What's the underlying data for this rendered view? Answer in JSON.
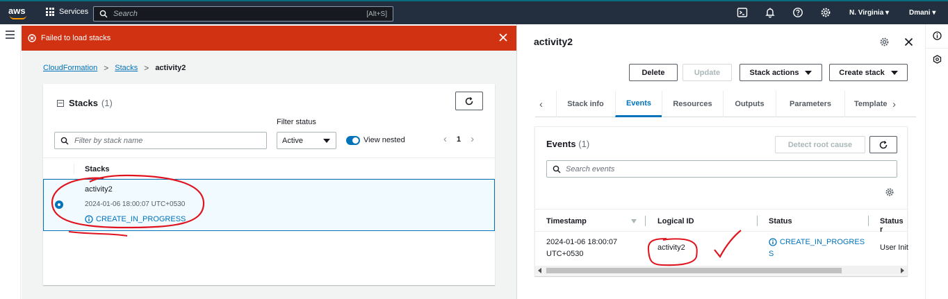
{
  "nav": {
    "logo": "aws",
    "services_label": "Services",
    "search_placeholder": "Search",
    "search_shortcut": "[Alt+S]",
    "region": "N. Virginia ▾",
    "user": "Dmani ▾"
  },
  "banner": {
    "message": "Failed to load stacks",
    "color": "#d13212"
  },
  "breadcrumb": {
    "items": [
      "CloudFormation",
      "Stacks"
    ],
    "current": "activity2"
  },
  "stacks": {
    "title": "Stacks",
    "count": "(1)",
    "filter_placeholder": "Filter by stack name",
    "filter_status_label": "Filter status",
    "filter_status_value": "Active",
    "view_nested_label": "View nested",
    "view_nested_on": true,
    "page": "1",
    "column": "Stacks",
    "rows": [
      {
        "name": "activity2",
        "created": "2024-01-06 18:00:07 UTC+0530",
        "status": "CREATE_IN_PROGRESS",
        "selected": true
      }
    ]
  },
  "detail": {
    "title": "activity2",
    "buttons": {
      "delete": "Delete",
      "update": "Update",
      "stack_actions": "Stack actions",
      "create_stack": "Create stack"
    },
    "tabs": [
      "Stack info",
      "Events",
      "Resources",
      "Outputs",
      "Parameters",
      "Template"
    ],
    "active_tab": "Events",
    "events": {
      "title": "Events",
      "count": "(1)",
      "detect_root_cause": "Detect root cause",
      "search_placeholder": "Search events",
      "columns": [
        "Timestamp",
        "Logical ID",
        "Status",
        "Status r"
      ],
      "rows": [
        {
          "timestamp_line1": "2024-01-06 18:00:07",
          "timestamp_line2": "UTC+0530",
          "logical_id": "activity2",
          "status_line1": "CREATE_IN_PROGRES",
          "status_line2": "S",
          "reason": "User Init"
        }
      ]
    }
  },
  "colors": {
    "nav_bg": "#232f3e",
    "link": "#0073bb",
    "annotation": "#e0141e"
  }
}
